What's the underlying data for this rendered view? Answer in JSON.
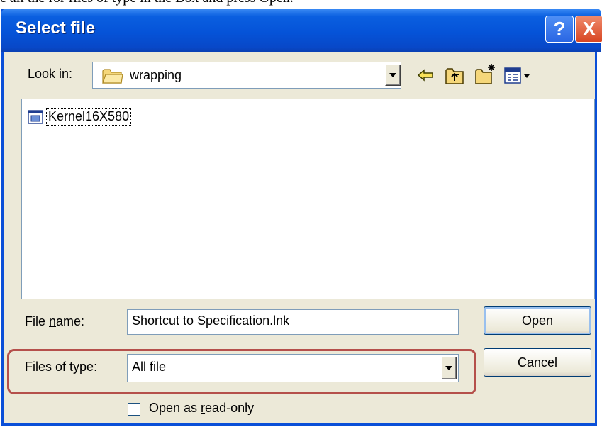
{
  "caption": "e all the for files of type in the Box and press Open.",
  "dialog": {
    "title": "Select file",
    "help_label": "?",
    "close_label": "X"
  },
  "look_in": {
    "label_pre": "Look ",
    "label_u": "i",
    "label_post": "n:",
    "value": "wrapping"
  },
  "toolbar": {
    "back_icon": "back-arrow-icon",
    "up_icon": "up-folder-icon",
    "new_folder_icon": "new-folder-icon",
    "view_icon": "view-menu-icon"
  },
  "files": [
    {
      "name": "Kernel16X580",
      "icon": "application-file-icon"
    }
  ],
  "file_name": {
    "label_pre": "File ",
    "label_u": "n",
    "label_post": "ame:",
    "value": "Shortcut to Specification.lnk"
  },
  "files_of_type": {
    "label_pre": "Files of ",
    "label_u": "t",
    "label_post": "ype:",
    "value": "All file"
  },
  "buttons": {
    "open_u": "O",
    "open_rest": "pen",
    "cancel": "Cancel"
  },
  "read_only": {
    "label_pre": "Open as ",
    "label_u": "r",
    "label_post": "ead-only",
    "checked": false
  },
  "colors": {
    "title_bar": "#0553d8",
    "dialog_bg": "#ece9d8",
    "highlight": "#b5504b",
    "close_button": "#d84622"
  }
}
